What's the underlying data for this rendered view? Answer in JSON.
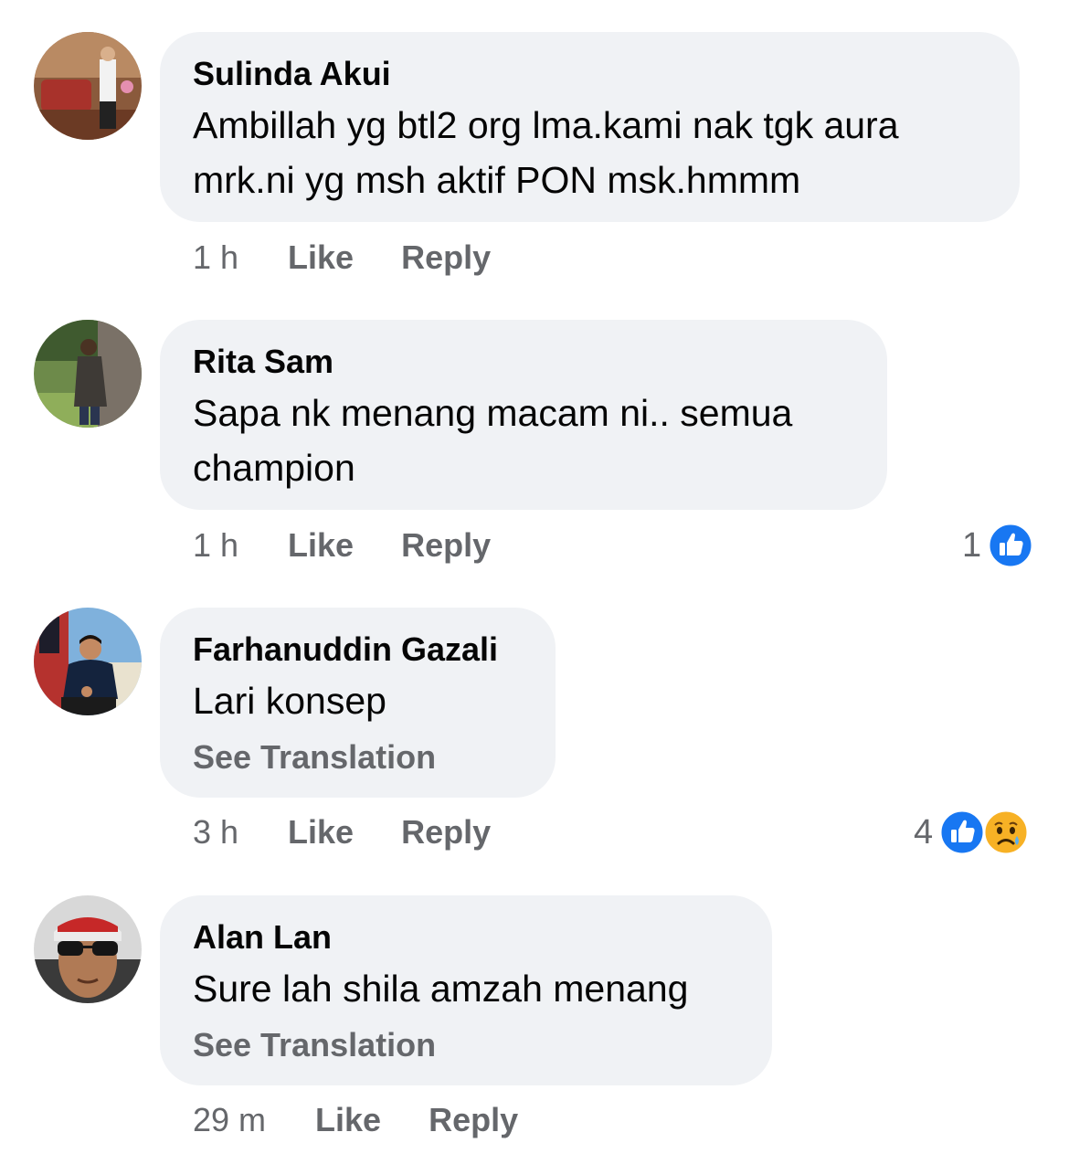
{
  "comments": [
    {
      "author": "Sulinda Akui",
      "lines": [
        "Ambillah yg btl2 org lma.kami nak tgk aura",
        "mrk.ni yg msh aktif PON msk.hmmm"
      ],
      "time": "1 h",
      "like": "Like",
      "reply": "Reply"
    },
    {
      "author": "Rita Sam",
      "lines": [
        "Sapa nk menang macam ni.. semua",
        "champion"
      ],
      "time": "1 h",
      "like": "Like",
      "reply": "Reply",
      "reaction_count": "1",
      "reaction_icons": [
        "like-icon"
      ]
    },
    {
      "author": "Farhanuddin Gazali",
      "lines": [
        "Lari konsep"
      ],
      "see_translation": "See Translation",
      "time": "3 h",
      "like": "Like",
      "reply": "Reply",
      "reaction_count": "4",
      "reaction_icons": [
        "like-icon",
        "sad-icon"
      ]
    },
    {
      "author": "Alan Lan",
      "lines": [
        "Sure lah shila amzah menang"
      ],
      "see_translation": "See Translation",
      "time": "29 m",
      "like": "Like",
      "reply": "Reply"
    }
  ],
  "colors": {
    "bubble": "#f0f2f5",
    "secondary_text": "#65676b",
    "like_blue": "#1877f2",
    "sad_yellow": "#f7b125"
  }
}
